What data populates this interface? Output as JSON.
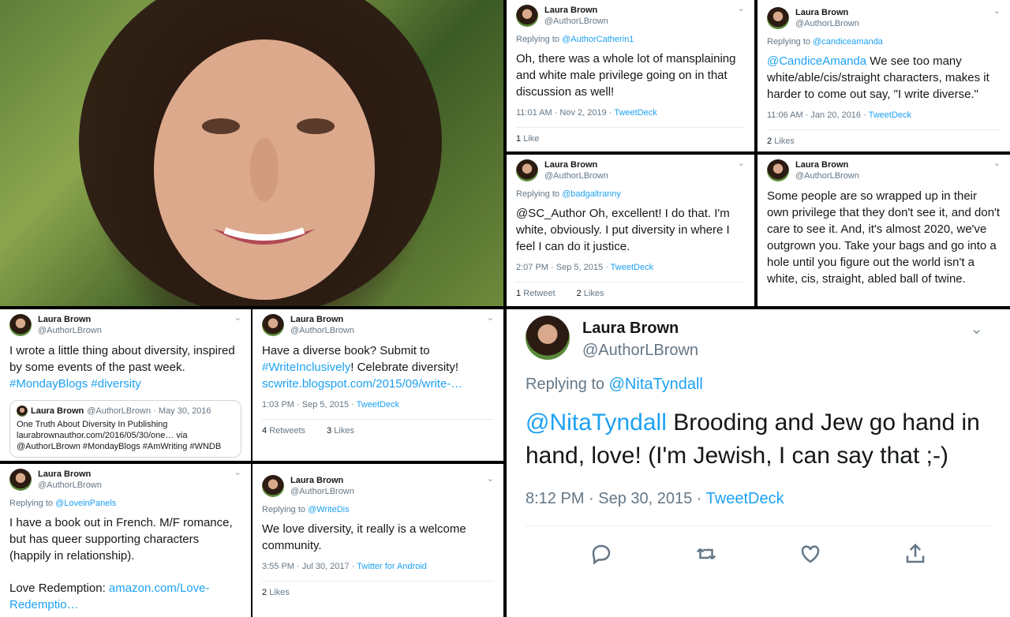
{
  "tweets": {
    "t1": {
      "name": "Laura Brown",
      "handle": "@AuthorLBrown",
      "reply_prefix": "Replying to ",
      "reply_to": "@AuthorCatherin1",
      "text": "Oh, there was a whole lot of mansplaining and white male privilege going on in that discussion as well!",
      "time": "11:01 AM · Nov 2, 2019 · ",
      "source": "TweetDeck",
      "likes_num": "1",
      "likes_label": "Like"
    },
    "t2": {
      "name": "Laura Brown",
      "handle": "@AuthorLBrown",
      "reply_prefix": "Replying to ",
      "reply_to": "@candiceamanda",
      "mention": "@CandiceAmanda",
      "text": " We see too many white/able/cis/straight characters, makes it harder to come out say, \"I write diverse.\"",
      "time": "11:06 AM · Jan 20, 2016 · ",
      "source": "TweetDeck",
      "likes_num": "2",
      "likes_label": "Likes"
    },
    "t3": {
      "name": "Laura Brown",
      "handle": "@AuthorLBrown",
      "reply_prefix": "Replying to ",
      "reply_to": "@badgaltranny",
      "text": "@SC_Author Oh, excellent! I do that. I'm white, obviously. I put diversity in where I feel I can do it justice.",
      "time": "2:07 PM · Sep 5, 2015 · ",
      "source": "TweetDeck",
      "retweets_num": "1",
      "retweets_label": "Retweet",
      "likes_num": "2",
      "likes_label": "Likes"
    },
    "t4": {
      "name": "Laura Brown",
      "handle": "@AuthorLBrown",
      "text": "Some people are so wrapped up in their own privilege that they don't see it, and don't care to see it. And, it's almost 2020, we've outgrown you. Take your bags and go into a hole until you figure out the world isn't a white, cis, straight, abled ball of twine."
    },
    "t5": {
      "name": "Laura Brown",
      "handle": "@AuthorLBrown",
      "text": "I wrote a little thing about diversity, inspired by some events of the past week. ",
      "tags": "#MondayBlogs #diversity",
      "quote_name": "Laura Brown",
      "quote_meta": "@AuthorLBrown · May 30, 2016",
      "quote_line1": "One Truth About Diversity In Publishing",
      "quote_line2": "laurabrownauthor.com/2016/05/30/one… via",
      "quote_line3": "@AuthorLBrown #MondayBlogs #AmWriting #WNDB"
    },
    "t6": {
      "name": "Laura Brown",
      "handle": "@AuthorLBrown",
      "text": "Have a diverse book? Submit to ",
      "tag": "#WriteInclusively",
      "text2": "! Celebrate diversity! ",
      "link": "scwrite.blogspot.com/2015/09/write-…",
      "time": "1:03 PM · Sep 5, 2015 · ",
      "source": "TweetDeck",
      "retweets_num": "4",
      "retweets_label": "Retweets",
      "likes_num": "3",
      "likes_label": "Likes"
    },
    "t7": {
      "name": "Laura Brown",
      "handle": "@AuthorLBrown",
      "reply_prefix": "Replying to ",
      "reply_to": "@LoveinPanels",
      "text": "I have a book out in French. M/F romance, but has queer supporting characters (happily in relationship).",
      "text2": "Love Redemption: ",
      "link": "amazon.com/Love-Redemptio…"
    },
    "t8": {
      "name": "Laura Brown",
      "handle": "@AuthorLBrown",
      "reply_prefix": "Replying to ",
      "reply_to": "@WriteDis",
      "text": "We love diversity, it really is a welcome community.",
      "time": "3:55 PM · Jul 30, 2017 · ",
      "source": "Twitter for Android",
      "likes_num": "2",
      "likes_label": "Likes"
    },
    "t9": {
      "name": "Laura Brown",
      "handle": "@AuthorLBrown",
      "reply_prefix": "Replying to ",
      "reply_to": "@NitaTyndall",
      "mention": "@NitaTyndall",
      "text": " Brooding and Jew go hand in hand, love! (I'm Jewish, I can say that ;-)",
      "time": "8:12 PM · Sep 30, 2015 · ",
      "source": "TweetDeck"
    }
  },
  "icons": {
    "chevron": "⌄",
    "reply": "reply-icon",
    "retweet": "retweet-icon",
    "like": "heart-icon",
    "share": "share-icon"
  },
  "colors": {
    "link": "#1da1f2",
    "muted": "#657786"
  }
}
